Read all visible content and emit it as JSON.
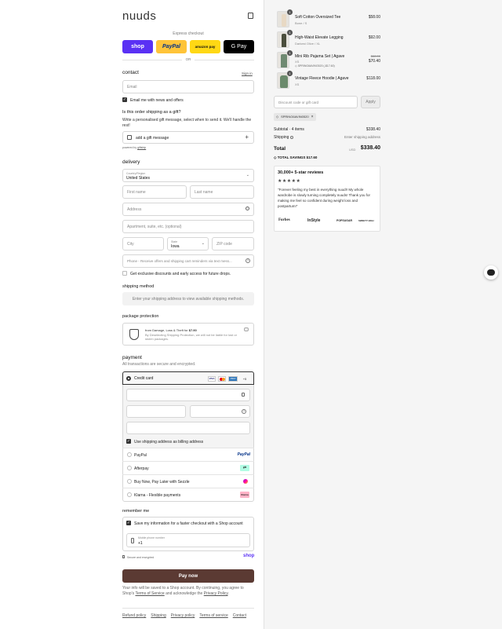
{
  "brand": {
    "logo": "nuuds"
  },
  "express": {
    "label": "Express checkout",
    "shop": "shop",
    "paypal": "PayPal",
    "amazon": "amazon pay",
    "gpay": "G Pay",
    "or": "OR"
  },
  "contact": {
    "title": "contact",
    "signin": "Sign in",
    "email_placeholder": "Email",
    "news_label": "Email me with news and offers"
  },
  "gift": {
    "question": "Is this order shipping as a gift?",
    "desc": "Write a personalised gift message, select when to send it. We'll handle the rest!",
    "add_label": "add a gift message",
    "powered": "powered by",
    "powered_brand": "giftship"
  },
  "delivery": {
    "title": "delivery",
    "country_label": "Country/Region",
    "country_value": "United States",
    "first_name": "First name",
    "last_name": "Last name",
    "address": "Address",
    "apartment": "Apartment, suite, etc. (optional)",
    "city": "City",
    "state_label": "State",
    "state_value": "Iowa",
    "zip": "ZIP code",
    "phone": "Phone - Receive offers and shipping cart reminders via text mess...",
    "text_offer": "Get exclusive discounts and early access for future drops."
  },
  "shipping": {
    "title": "shipping method",
    "notice": "Enter your shipping address to view available shipping methods."
  },
  "protection": {
    "title": "package protection",
    "line1_prefix": "from Damage, Loss & Theft for",
    "line1_price": "$7.90",
    "line2": "By Deselecting Shipping Protection, we will not be liable for lost or stolen packages."
  },
  "payment": {
    "title": "payment",
    "subtitle": "All transactions are secure and encrypted.",
    "credit_card": "Credit card",
    "more_cards": "+5",
    "billing_label": "Use shipping address as billing address",
    "options": [
      {
        "name": "PayPal",
        "logo": "PayPal",
        "color": "#003087"
      },
      {
        "name": "Afterpay",
        "logo": "afterpay",
        "color": "#b2fce4"
      },
      {
        "name": "Buy Now, Pay Later with Sezzle",
        "logo": "sezzle",
        "color": "#8333d4"
      },
      {
        "name": "Klarna - Flexible payments",
        "logo": "Klarna",
        "color": "#ffb3c7"
      }
    ]
  },
  "remember": {
    "title": "remember me",
    "save_label": "Save my information for a faster checkout with a Shop account",
    "phone_label": "Mobile phone number",
    "phone_value": "+1",
    "secure": "Secure and encrypted",
    "shop": "shop"
  },
  "pay_button": "Pay now",
  "legal": {
    "text1": "Your info will be saved to a Shop account. By continuing, you agree to Shop's",
    "tos": "Terms of Service",
    "text2": "and acknowledge the",
    "privacy": "Privacy Policy",
    "end": "."
  },
  "footer_links": [
    "Refund policy",
    "Shipping",
    "Privacy policy",
    "Terms of service",
    "Contact"
  ],
  "cart": {
    "items": [
      {
        "qty": "1",
        "name": "Soft Cotton Oversized Tee",
        "variant": "Bone / S",
        "price": "$58.00"
      },
      {
        "qty": "1",
        "name": "High-Waist Elevate Legging",
        "variant": "Darkest Olive / XL",
        "price": "$92.00"
      },
      {
        "qty": "1",
        "name": "Mini Rib Pajama Set | Agave",
        "variant": "XS",
        "discount": "SPRING6AVING520 (-$17.60)",
        "old_price": "$88.00",
        "price": "$70.40"
      },
      {
        "qty": "1",
        "name": "Vintage Fleece Hoodie | Agave",
        "variant": "XS",
        "price": "$118.00"
      }
    ],
    "discount_placeholder": "Discount code or gift card",
    "apply": "Apply",
    "code_tag": "SPRING6AVIN0520",
    "subtotal_label": "Subtotal · 4 items",
    "subtotal_value": "$338.40",
    "shipping_label": "Shipping",
    "shipping_value": "Enter shipping address",
    "total_label": "Total",
    "currency": "USD",
    "total_value": "$338.40",
    "savings_label": "TOTAL SAVINGS",
    "savings_value": "$17.60"
  },
  "reviews": {
    "title": "30,000+ 5-star reviews",
    "stars": "★★★★★",
    "quote": "\"Forever feeling my best in everything nuud!! My whole wardrobe is slowly turning completely nuuds! Thank you for making me feel so confident during weight loss and postpartum!\"",
    "logos": [
      "Forbes",
      "InStyle",
      "POPSUGAR",
      "SWEETY HIGH"
    ]
  },
  "colors": {
    "pay_button": "#5b3a33",
    "shop_purple": "#5a31f4",
    "paypal_yellow": "#ffc439"
  }
}
